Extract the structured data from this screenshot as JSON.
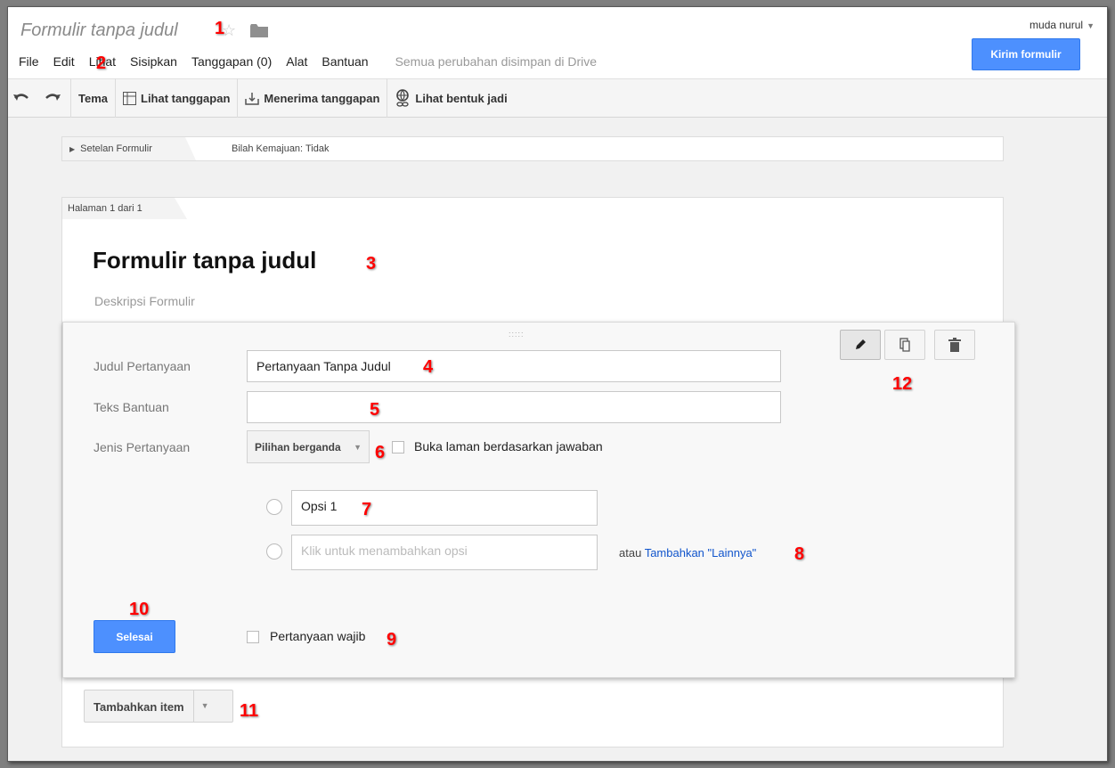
{
  "header": {
    "doc_title": "Formulir tanpa judul",
    "user": "muda nurul",
    "send_button": "Kirim formulir"
  },
  "menu": {
    "items": [
      "File",
      "Edit",
      "Lihat",
      "Sisipkan",
      "Tanggapan (0)",
      "Alat",
      "Bantuan"
    ],
    "save_status": "Semua perubahan disimpan di Drive"
  },
  "toolbar": {
    "theme": "Tema",
    "view_responses": "Lihat tanggapan",
    "accept_responses": "Menerima tanggapan",
    "view_live": "Lihat bentuk jadi"
  },
  "settings": {
    "tab_label": "Setelan Formulir",
    "progress_bar": "Bilah Kemajuan: Tidak"
  },
  "form": {
    "page_label": "Halaman 1 dari 1",
    "title": "Formulir tanpa judul",
    "description_placeholder": "Deskripsi Formulir"
  },
  "question": {
    "title_label": "Judul Pertanyaan",
    "title_value": "Pertanyaan Tanpa Judul",
    "help_label": "Teks Bantuan",
    "help_value": "",
    "type_label": "Jenis Pertanyaan",
    "type_value": "Pilihan berganda",
    "page_nav_label": "Buka laman berdasarkan jawaban",
    "option_1": "Opsi 1",
    "add_option_placeholder": "Klik untuk menambahkan opsi",
    "or_text": "atau",
    "add_other_link": "Tambahkan \"Lainnya\"",
    "done_button": "Selesai",
    "required_label": "Pertanyaan wajib"
  },
  "add_item": {
    "label": "Tambahkan item"
  },
  "annotations": [
    "1",
    "2",
    "3",
    "4",
    "5",
    "6",
    "7",
    "8",
    "9",
    "10",
    "11",
    "12"
  ],
  "colors": {
    "primary_blue": "#4d90fe",
    "link_blue": "#1155cc",
    "annotation_red": "#ff0000"
  }
}
